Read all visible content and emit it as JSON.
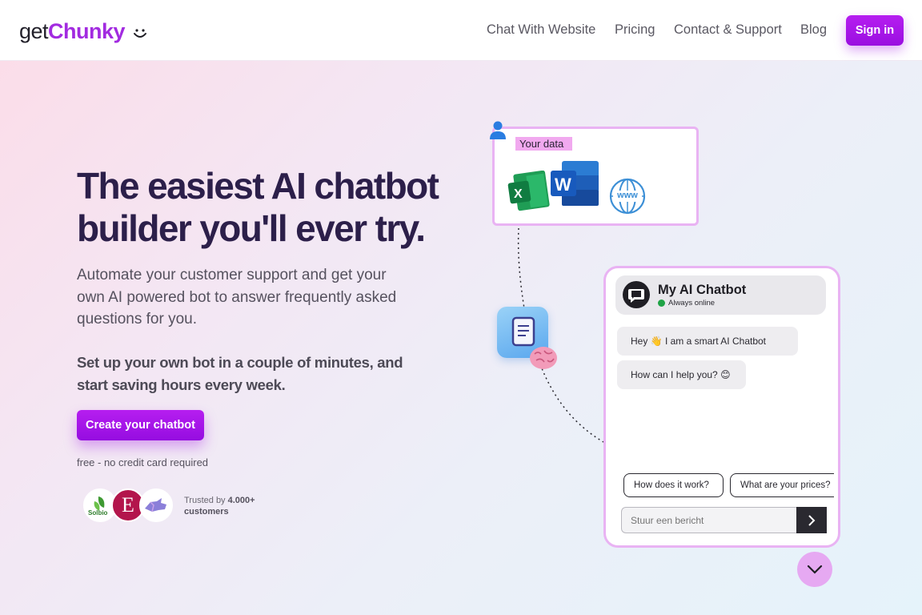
{
  "header": {
    "logo_prefix": "get",
    "logo_brand": "Chunky",
    "nav": [
      "Chat With Website",
      "Pricing",
      "Contact & Support",
      "Blog"
    ],
    "signin_label": "Sign in"
  },
  "hero": {
    "title": "The easiest AI chatbot builder you'll ever try.",
    "lead": "Automate your customer support and get your own AI powered bot to answer frequently asked questions for you.",
    "lead2": "Set up your own bot in a couple of minutes, and start saving hours every week.",
    "cta_label": "Create your chatbot",
    "cta_note": "free - no credit card required",
    "trusted_prefix": "Trusted by ",
    "trusted_count": "4.000+",
    "trusted_suffix": "customers",
    "avatar_logos": [
      "Solbio",
      "E",
      ""
    ]
  },
  "illustration": {
    "data_label": "Your data",
    "data_icons": [
      "excel-icon",
      "word-icon",
      "globe-www-icon"
    ],
    "www_label": "www",
    "excel_letter": "X",
    "word_letter": "W"
  },
  "chatbot": {
    "title": "My AI Chatbot",
    "status": "Always online",
    "messages": [
      "Hey 👋 I am a smart AI Chatbot",
      "How can I help you? 😊"
    ],
    "quick_replies": [
      "How does it work?",
      "What are your prices?"
    ],
    "input_placeholder": "Stuur een bericht"
  },
  "colors": {
    "brand": "#a22be0",
    "border_pink": "#e9b3f3",
    "online": "#1fa346"
  }
}
